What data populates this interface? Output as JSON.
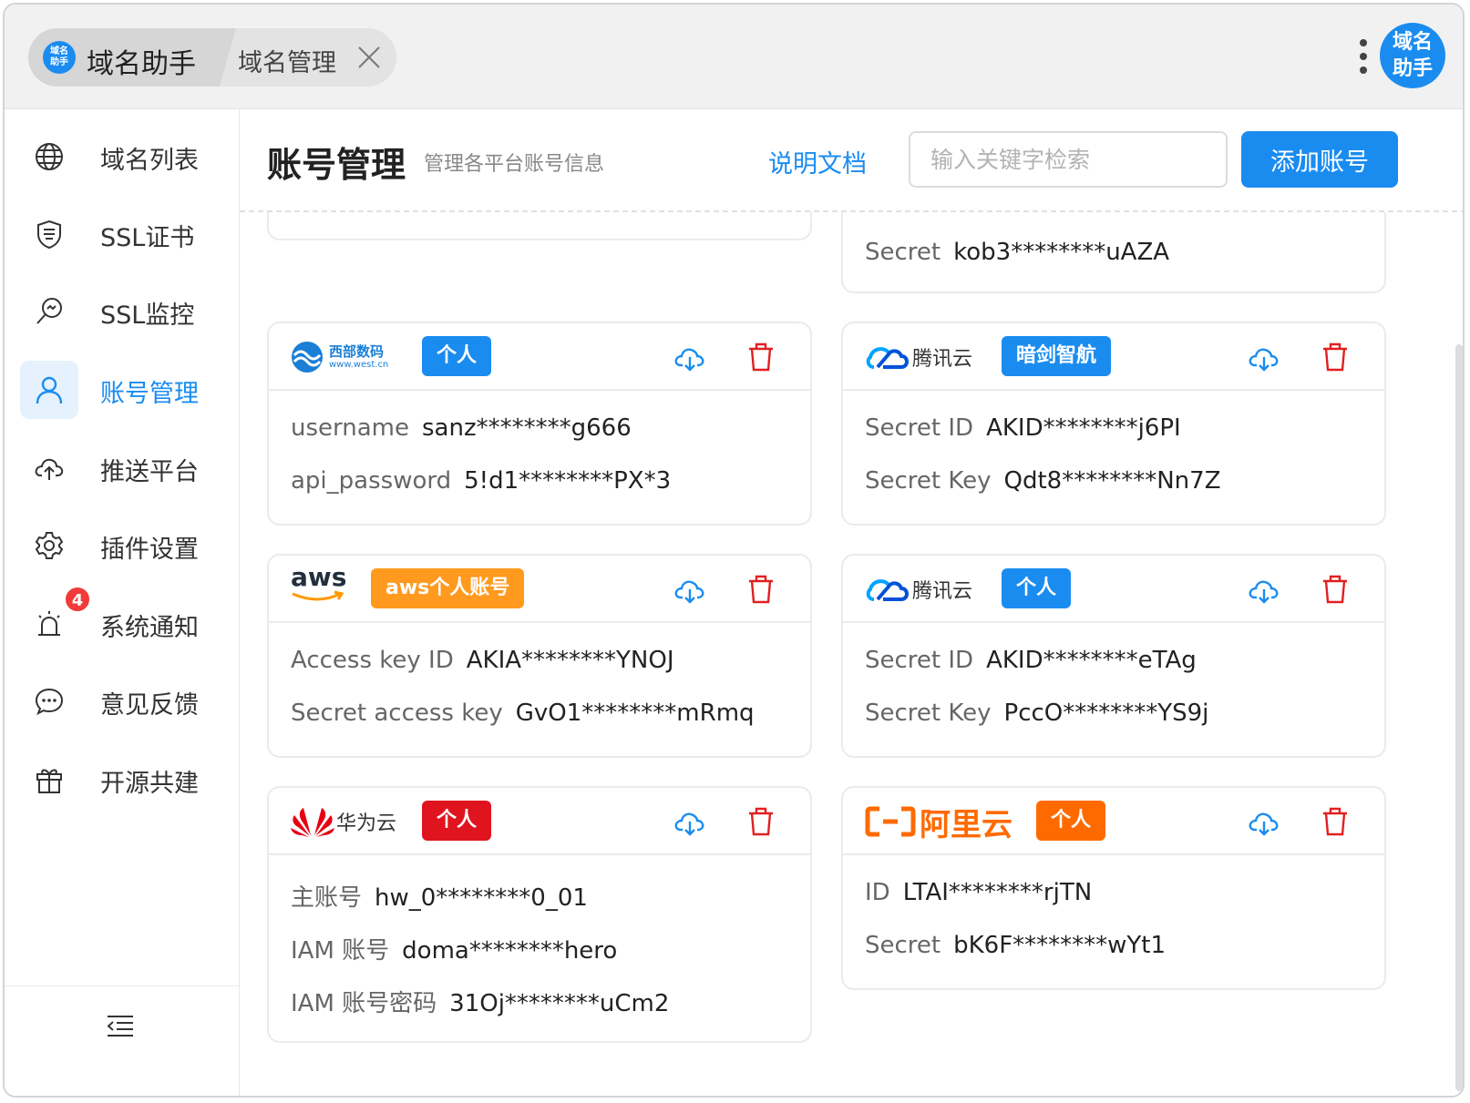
{
  "app": {
    "tab_logo_text": "域名\n助手",
    "tab_title": "域名助手",
    "tab2_label": "域名管理",
    "avatar_text": "域名\n助手"
  },
  "colors": {
    "primary": "#1a8cf0",
    "danger": "#e02020",
    "orange": "#ff9a1e",
    "aliyun": "#ff6a00",
    "west_blue": "#1a7fd6"
  },
  "sidebar": {
    "items": [
      {
        "label": "域名列表",
        "icon": "globe-icon"
      },
      {
        "label": "SSL证书",
        "icon": "shield-certificate-icon"
      },
      {
        "label": "SSL监控",
        "icon": "monitor-search-icon"
      },
      {
        "label": "账号管理",
        "icon": "user-icon",
        "active": true
      },
      {
        "label": "推送平台",
        "icon": "cloud-upload-icon"
      },
      {
        "label": "插件设置",
        "icon": "gear-icon"
      },
      {
        "label": "系统通知",
        "icon": "alarm-icon",
        "badge": "4"
      },
      {
        "label": "意见反馈",
        "icon": "chat-icon"
      },
      {
        "label": "开源共建",
        "icon": "gift-icon"
      }
    ],
    "collapse_icon": "menu-collapse-icon"
  },
  "header": {
    "title": "账号管理",
    "subtitle": "管理各平台账号信息",
    "doc_link": "说明文档",
    "search_placeholder": "输入关键字检索",
    "add_button": "添加账号"
  },
  "cards": [
    {
      "partial": true,
      "rows": []
    },
    {
      "partial": true,
      "rows": [
        {
          "key": "Secret",
          "value": "kob3********uAZA"
        }
      ]
    },
    {
      "platform": "西部数码",
      "logo_sub": "www.west.cn",
      "tag": "个人",
      "rows": [
        {
          "key": "username",
          "value": "sanz********g666"
        },
        {
          "key": "api_password",
          "value": "5!d1********PX*3"
        }
      ]
    },
    {
      "platform": "腾讯云",
      "tag": "暗剑智航",
      "rows": [
        {
          "key": "Secret ID",
          "value": "AKID********j6PI"
        },
        {
          "key": "Secret Key",
          "value": "Qdt8********Nn7Z"
        }
      ]
    },
    {
      "platform": "aws",
      "tag": "aws个人账号",
      "rows": [
        {
          "key": "Access key ID",
          "value": "AKIA********YNOJ"
        },
        {
          "key": "Secret access key",
          "value": "GvO1********mRmq"
        }
      ]
    },
    {
      "platform": "腾讯云",
      "tag": "个人",
      "rows": [
        {
          "key": "Secret ID",
          "value": "AKID********eTAg"
        },
        {
          "key": "Secret Key",
          "value": "PccO********YS9j"
        }
      ]
    },
    {
      "platform": "华为云",
      "tag": "个人",
      "rows": [
        {
          "key": "主账号",
          "value": "hw_0********0_01"
        },
        {
          "key": "IAM 账号",
          "value": "doma********hero"
        },
        {
          "key": "IAM 账号密码",
          "value": "31Oj********uCm2"
        }
      ]
    },
    {
      "platform": "阿里云",
      "tag": "个人",
      "rows": [
        {
          "key": "ID",
          "value": "LTAI********rjTN"
        },
        {
          "key": "Secret",
          "value": "bK6F********wYt1"
        }
      ]
    }
  ]
}
